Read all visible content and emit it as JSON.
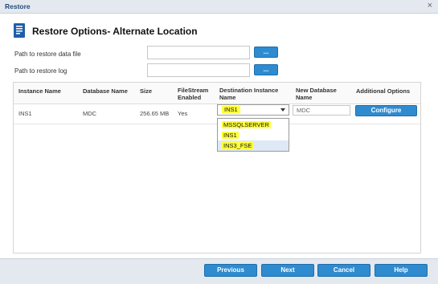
{
  "window": {
    "title": "Restore",
    "close_glyph": "×"
  },
  "header": {
    "title": "Restore Options- Alternate Location",
    "icon": "document-restore-icon"
  },
  "paths": {
    "data_file_label": "Path to restore data file",
    "data_file_value": "",
    "log_label": "Path to restore log",
    "log_value": "",
    "browse_label": "..."
  },
  "table": {
    "columns": [
      "Instance Name",
      "Database Name",
      "Size",
      "FileStream Enabled",
      "Destination Instance Name",
      "New Database Name",
      "Additional Options"
    ],
    "rows": [
      {
        "instance_name": "INS1",
        "database_name": "MDC",
        "size": "256.65 MB",
        "filestream_enabled": "Yes",
        "destination_instance": "INS1",
        "new_database_name": "MDC",
        "additional_options_button": "Configure"
      }
    ]
  },
  "dropdown": {
    "options": [
      "MSSQLSERVER",
      "INS1",
      "INS3_FSE"
    ]
  },
  "footer": {
    "previous": "Previous",
    "next": "Next",
    "cancel": "Cancel",
    "help": "Help"
  },
  "colors": {
    "accent": "#2f8bd0",
    "highlight": "#ffff3c",
    "title_bar": "#e4e9ef"
  }
}
